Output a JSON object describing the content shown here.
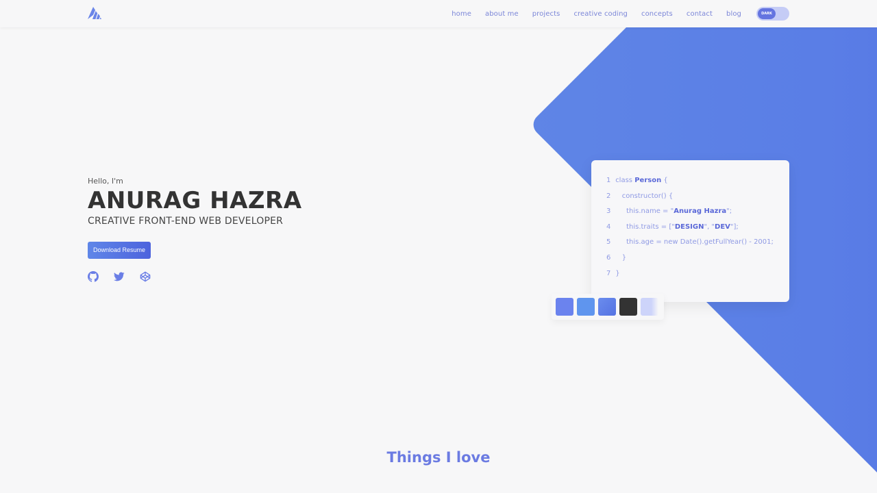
{
  "nav": {
    "items": [
      {
        "label": "home"
      },
      {
        "label": "about me"
      },
      {
        "label": "projects"
      },
      {
        "label": "creative coding"
      },
      {
        "label": "concepts"
      },
      {
        "label": "contact"
      },
      {
        "label": "blog"
      }
    ],
    "theme_toggle_label": "DARK"
  },
  "hero": {
    "greeting": "Hello, I'm",
    "name": "ANURAG HAZRA",
    "role": "CREATIVE FRONT-END WEB DEVELOPER",
    "download_label": "Download Resume",
    "socials": [
      "github-icon",
      "twitter-icon",
      "codepen-icon"
    ]
  },
  "code": {
    "lines": [
      {
        "n": "1",
        "pre": "class ",
        "bold": "Person",
        "post": " {"
      },
      {
        "n": "2",
        "pre": "   constructor() {",
        "bold": "",
        "post": ""
      },
      {
        "n": "3",
        "pre": "     this.name = \"",
        "bold": "Anurag Hazra",
        "post": "\";"
      },
      {
        "n": "4",
        "pre": "     this.traits = [\"",
        "bold": "DESIGN",
        "post": "\", \"",
        "bold2": "DEV",
        "post2": "\"];"
      },
      {
        "n": "5",
        "pre": "     this.age = new Date().getFullYear() - 2001;",
        "bold": "",
        "post": ""
      },
      {
        "n": "6",
        "pre": "   }",
        "bold": "",
        "post": ""
      },
      {
        "n": "7",
        "pre": "}",
        "bold": "",
        "post": ""
      }
    ]
  },
  "palette": {
    "colors": [
      "#6b83ee",
      "#5f95ee",
      "#5573e2",
      "#333333",
      "#cdd4fa"
    ]
  },
  "sections": {
    "things_title": "Things I love"
  },
  "colors": {
    "accent": "#6b7be2",
    "gradient_start": "#5f85e6",
    "gradient_end": "#4d64dd",
    "background": "#f7f7f8"
  }
}
